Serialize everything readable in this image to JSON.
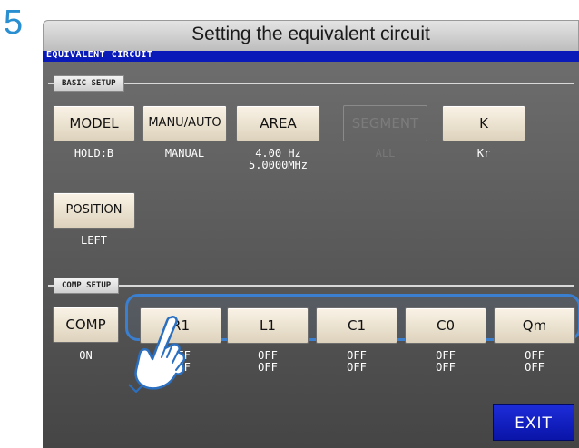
{
  "step_number": "5",
  "banner_title": "Setting the equivalent circuit",
  "screen_title": "EQUIVALENT CIRCUIT",
  "basic_setup": {
    "label": "BASIC SETUP",
    "buttons": [
      {
        "label": "MODEL",
        "value": "HOLD:B"
      },
      {
        "label": "MANU/AUTO",
        "value": "MANUAL"
      },
      {
        "label": "AREA",
        "value": "4.00 Hz\n5.0000MHz"
      },
      {
        "label": "SEGMENT",
        "value": "ALL",
        "disabled": true
      },
      {
        "label": "K",
        "value": "Kr"
      },
      {
        "label": "POSITION",
        "value": "LEFT"
      }
    ]
  },
  "comp_setup": {
    "label": "COMP SETUP",
    "comp": {
      "label": "COMP",
      "value": "ON"
    },
    "params": [
      {
        "label": "R1",
        "value": "OFF\nOFF"
      },
      {
        "label": "L1",
        "value": "OFF\nOFF"
      },
      {
        "label": "C1",
        "value": "OFF\nOFF"
      },
      {
        "label": "C0",
        "value": "OFF\nOFF"
      },
      {
        "label": "Qm",
        "value": "OFF\nOFF"
      }
    ]
  },
  "exit_label": "EXIT",
  "colors": {
    "accent": "#2a8fd0",
    "titlebar": "#0a1ab8",
    "highlight": "#3a7fd0",
    "exit": "#1c2cd8"
  }
}
